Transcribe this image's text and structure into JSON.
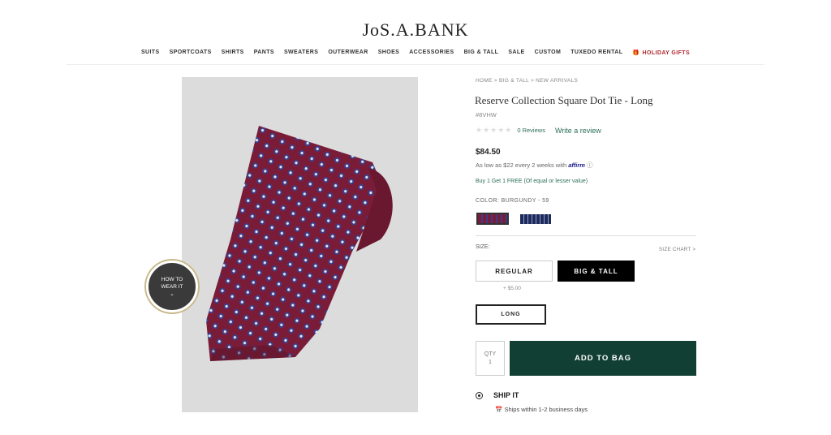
{
  "brand": {
    "logo_text": "JoS.A.BANK"
  },
  "nav": {
    "items": [
      "SUITS",
      "SPORTCOATS",
      "SHIRTS",
      "PANTS",
      "SWEATERS",
      "OUTERWEAR",
      "SHOES",
      "ACCESSORIES",
      "BIG & TALL",
      "SALE",
      "CUSTOM",
      "TUXEDO RENTAL"
    ],
    "holiday": "HOLIDAY GIFTS",
    "holiday_icon": "gift-icon",
    "holiday_color": "#b3262d"
  },
  "breadcrumb": "HOME > BIG & TALL > NEW ARRIVALS",
  "product": {
    "title": "Reserve Collection Square Dot Tie - Long",
    "sku": "#8VHW",
    "reviews_label": "0 Reviews",
    "write_review": "Write a review",
    "price": "$84.50",
    "affirm_text": "As low as $22 every 2 weeks with",
    "affirm_brand": "affirm",
    "promo": "Buy 1 Get 1 FREE (Of equal or lesser value)",
    "color_label": "COLOR: BURGUNDY - 59",
    "size_label": "SIZE:",
    "size_chart": "SIZE CHART >",
    "sizes": {
      "regular": "REGULAR",
      "big_tall": "BIG & TALL",
      "surcharge": "+ $5.00",
      "length": "LONG"
    },
    "selected_size": "BIG & TALL",
    "qty_label": "QTY",
    "qty_value": "1",
    "add_to_bag": "ADD TO BAG",
    "add_color": "#123f33",
    "ship_label": "SHIP IT",
    "ship_detail": "Ships within 1-2 business days",
    "how_to_line1": "HOW TO",
    "how_to_line2": "WEAR IT"
  },
  "tie_colors": {
    "base": "#7a1c38",
    "dot_ring": "#3a3e8a",
    "dot_center": "#e8e6ef"
  }
}
